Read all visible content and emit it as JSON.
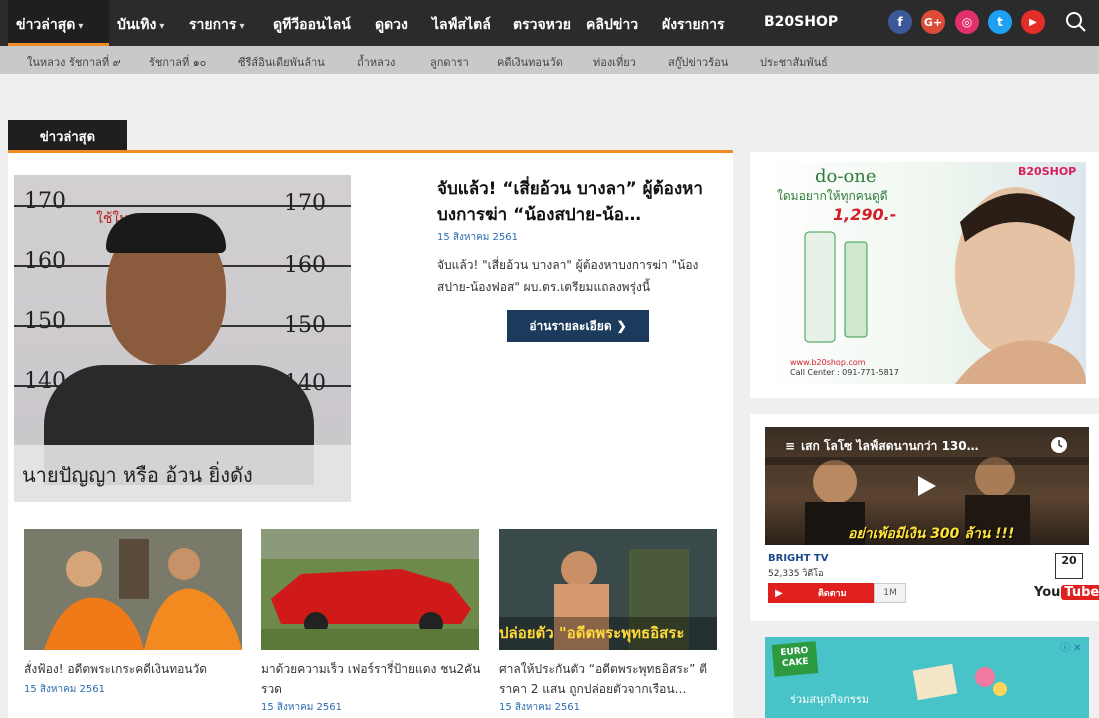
{
  "nav": {
    "items": [
      {
        "label": "ข่าวล่าสุด",
        "chevron": true
      },
      {
        "label": "บันเทิง",
        "chevron": true
      },
      {
        "label": "รายการ",
        "chevron": true
      },
      {
        "label": "ดูทีวีออนไลน์",
        "chevron": false
      },
      {
        "label": "ดูดวง",
        "chevron": false
      },
      {
        "label": "ไลฟ์สไตล์",
        "chevron": false
      },
      {
        "label": "ตรวจหวย",
        "chevron": false
      },
      {
        "label": "คลิปข่าว",
        "chevron": false
      },
      {
        "label": "ผังรายการ",
        "chevron": false
      },
      {
        "label": "B20SHOP",
        "chevron": false
      }
    ],
    "social": [
      {
        "name": "facebook-icon",
        "glyph": "f",
        "color": "#3b5998"
      },
      {
        "name": "google-plus-icon",
        "glyph": "G+",
        "color": "#dd4b39"
      },
      {
        "name": "instagram-icon",
        "glyph": "◎",
        "color": "#e1306c"
      },
      {
        "name": "twitter-icon",
        "glyph": "t",
        "color": "#1da1f2"
      },
      {
        "name": "youtube-icon",
        "glyph": "▶",
        "color": "#e52d27"
      }
    ]
  },
  "subnav": [
    "ในหลวง รัชกาลที่ ๙",
    "รัชกาลที่ ๑๐",
    "ซีรีส์อินเดียพันล้าน",
    "ถ้ำหลวง",
    "ลูกดารา",
    "คดีเงินทอนวัด",
    "ท่องเที่ยว",
    "สกู๊ปข่าวร้อน",
    "ประชาสัมพันธ์"
  ],
  "section": {
    "tab": "ข่าวล่าสุด"
  },
  "featured": {
    "title": "จับแล้ว! “เสี่ยอ้วน บางลา” ผู้ต้องหาบงการฆ่า “น้องสปาย-น้อ…",
    "date": "15 สิงหาคม 2561",
    "desc": "จับแล้ว! \"เสี่ยอ้วน บางลา\" ผู้ต้องหาบงการฆ่า \"น้องสปาย-น้องฟอส\" ผบ.ตร.เตรียมแถลงพรุ่งนี้",
    "button": "อ่านรายละเอียด",
    "photo_caption": "นายปัญญา หรือ อ้วน ยิ่งดัง",
    "photo_red_text": "ใช้ในราชการ ตร.",
    "height_marks": [
      "170",
      "170",
      "160",
      "160",
      "150",
      "150",
      "140",
      "140"
    ]
  },
  "cards": [
    {
      "title": "สั่งฟ้อง! อดีตพระเกระคดีเงินทอนวัด",
      "date": "15 สิงหาคม 2561"
    },
    {
      "title": "มาด้วยความเร็ว เฟอร์รารี่ป้ายแดง ชน2คันรวด",
      "date": "15 สิงหาคม 2561"
    },
    {
      "title": "ศาลให้ประกันตัว “อดีตพระพุทธอิสระ” ตีราคา 2 แสน ถูกปล่อยตัวจากเรือน…",
      "date": "15 สิงหาคม 2561",
      "img_text": "ปล่อยตัว \"อดีตพระพุทธอิสระ"
    }
  ],
  "sidebar": {
    "ad1": {
      "brand": "B20SHOP",
      "logo": "do-one",
      "line1": "ใดมอยากให้ทุกคนดูดี",
      "price": "1,290.-",
      "site": "www.b20shop.com",
      "call": "Call Center : 091-771-5817"
    },
    "video": {
      "title": "เสก โลโซ ไลฟ์สดนานกว่า 130…",
      "overlay": "อย่าเพ้อมีเงิน 300 ล้าน !!!",
      "channel": "BRIGHT TV",
      "views": "52,335 วิดีโอ",
      "subscribe": "ติดตาม",
      "count": "1M",
      "badge": "20",
      "yt_you": "You",
      "yt_tube": "Tube"
    },
    "ad2": {
      "logo": "EURO CAKE",
      "text": "ร่วมสนุกกิจกรรม",
      "close": "ⓘ ✕"
    }
  }
}
